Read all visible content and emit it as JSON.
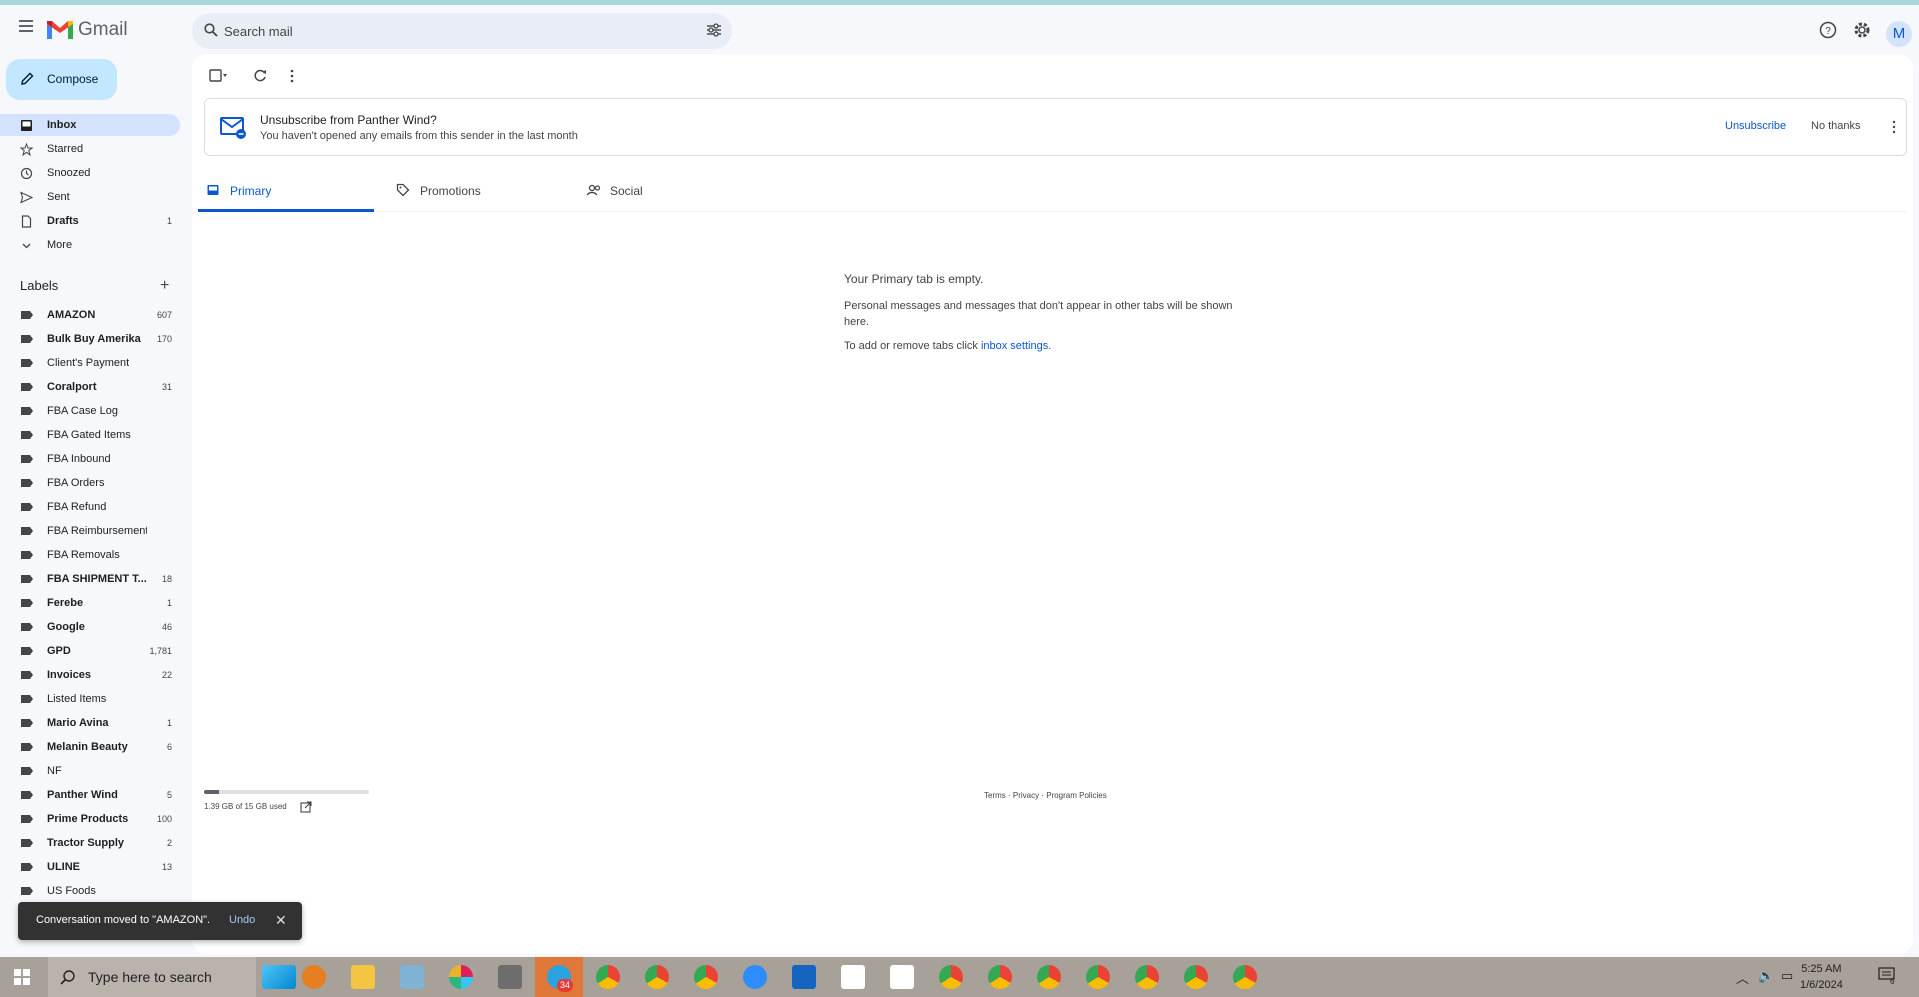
{
  "app": {
    "name": "Gmail"
  },
  "search": {
    "placeholder": "Search mail"
  },
  "header": {
    "avatar_letter": "M"
  },
  "compose": {
    "label": "Compose"
  },
  "nav": [
    {
      "label": "Inbox",
      "count": "",
      "bold": true,
      "active": true,
      "icon": "inbox-icon"
    },
    {
      "label": "Starred",
      "count": "",
      "icon": "star-icon"
    },
    {
      "label": "Snoozed",
      "count": "",
      "icon": "clock-icon"
    },
    {
      "label": "Sent",
      "count": "",
      "icon": "send-icon"
    },
    {
      "label": "Drafts",
      "count": "1",
      "bold": true,
      "icon": "draft-icon"
    },
    {
      "label": "More",
      "count": "",
      "icon": "chevron-down-icon"
    }
  ],
  "labels": {
    "header": "Labels",
    "items": [
      {
        "label": "AMAZON",
        "count": "607",
        "bold": true
      },
      {
        "label": "Bulk Buy Amerika",
        "count": "170",
        "bold": true
      },
      {
        "label": "Client's Payment",
        "count": ""
      },
      {
        "label": "Coralport",
        "count": "31",
        "bold": true
      },
      {
        "label": "FBA Case Log",
        "count": ""
      },
      {
        "label": "FBA Gated Items",
        "count": ""
      },
      {
        "label": "FBA Inbound",
        "count": ""
      },
      {
        "label": "FBA Orders",
        "count": ""
      },
      {
        "label": "FBA Refund",
        "count": ""
      },
      {
        "label": "FBA Reimbursement",
        "count": ""
      },
      {
        "label": "FBA Removals",
        "count": ""
      },
      {
        "label": "FBA SHIPMENT T...",
        "count": "18",
        "bold": true
      },
      {
        "label": "Ferebe",
        "count": "1",
        "bold": true
      },
      {
        "label": "Google",
        "count": "46",
        "bold": true
      },
      {
        "label": "GPD",
        "count": "1,781",
        "bold": true
      },
      {
        "label": "Invoices",
        "count": "22",
        "bold": true
      },
      {
        "label": "Listed Items",
        "count": ""
      },
      {
        "label": "Mario Avina",
        "count": "1",
        "bold": true
      },
      {
        "label": "Melanin Beauty",
        "count": "6",
        "bold": true
      },
      {
        "label": "NF",
        "count": ""
      },
      {
        "label": "Panther Wind",
        "count": "5",
        "bold": true
      },
      {
        "label": "Prime Products",
        "count": "100",
        "bold": true
      },
      {
        "label": "Tractor Supply",
        "count": "2",
        "bold": true
      },
      {
        "label": "ULINE",
        "count": "13",
        "bold": true
      },
      {
        "label": "US Foods",
        "count": ""
      }
    ]
  },
  "banner": {
    "title": "Unsubscribe from Panther Wind?",
    "subtitle": "You haven't opened any emails from this sender in the last month",
    "unsubscribe": "Unsubscribe",
    "no_thanks": "No thanks"
  },
  "tabs": [
    {
      "label": "Primary",
      "active": true
    },
    {
      "label": "Promotions"
    },
    {
      "label": "Social"
    }
  ],
  "empty": {
    "title": "Your Primary tab is empty.",
    "body": "Personal messages and messages that don't appear in other tabs will be shown here.",
    "settings_prefix": "To add or remove tabs click ",
    "settings_link": "inbox settings",
    "settings_suffix": "."
  },
  "storage": {
    "text": "1.39 GB of 15 GB used",
    "fraction": 0.093
  },
  "footer": {
    "terms": "Terms",
    "privacy": "Privacy",
    "policies": "Program Policies",
    "sep": " · "
  },
  "toast": {
    "message": "Conversation moved to \"AMAZON\".",
    "undo": "Undo",
    "close": "✕"
  },
  "taskbar": {
    "search_placeholder": "Type here to search",
    "badge": "34",
    "time": "5:25 AM",
    "date": "1/6/2024",
    "notification_count": "6"
  },
  "colors": {
    "accent": "#0b57d0",
    "compose": "#c2e7ff",
    "active_nav": "#d3e3fd"
  }
}
